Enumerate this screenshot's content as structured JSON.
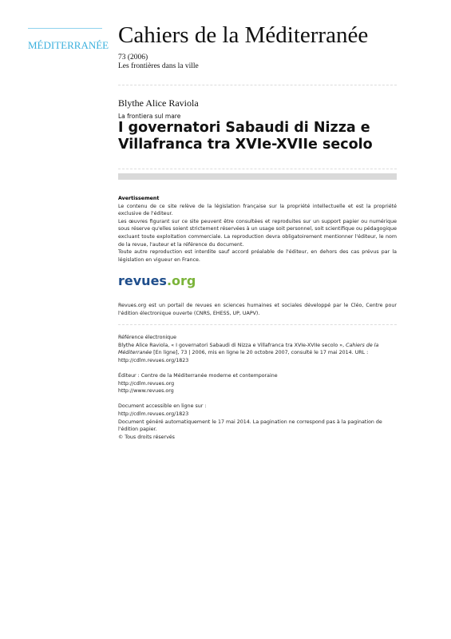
{
  "logo": {
    "text": "MÉDITERRANÉE"
  },
  "header": {
    "journal": "Cahiers de la Méditerranée",
    "issue": "73  (2006)",
    "theme": "Les frontières dans la ville"
  },
  "article": {
    "author": "Blythe Alice Raviola",
    "subtitle": "La frontiera sul mare",
    "title": "I governatori Sabaudi di Nizza e Villafranca tra XVIe-XVIIe secolo"
  },
  "warning": {
    "heading": "Avertissement",
    "paragraphs": [
      "Le contenu de ce site relève de la législation française sur la propriété intellectuelle et est la propriété exclusive de l'éditeur.",
      "Les œuvres figurant sur ce site peuvent être consultées et reproduites sur un support papier ou numérique sous réserve qu'elles soient strictement réservées à un usage soit personnel, soit scientifique ou pédagogique excluant toute exploitation commerciale. La reproduction devra obligatoirement mentionner l'éditeur, le nom de la revue, l'auteur et la référence du document.",
      "Toute autre reproduction est interdite sauf accord préalable de l'éditeur, en dehors des cas prévus par la législation en vigueur en France."
    ]
  },
  "revues": {
    "logo_a": "revues",
    "logo_b": ".org",
    "text": "Revues.org est un portail de revues en sciences humaines et sociales développé par le Cléo, Centre pour l'édition électronique ouverte (CNRS, EHESS, UP, UAPV)."
  },
  "reference": {
    "heading": "Référence électronique",
    "citation_a": "Blythe Alice Raviola, « I governatori Sabaudi di Nizza e Villafranca tra XVIe-XVIIe secolo », ",
    "citation_journal": "Cahiers de la Méditerranée",
    "citation_b": " [En ligne], 73 | 2006, mis en ligne le 20 octobre 2007, consulté le 17 mai 2014. URL : http://cdlm.revues.org/1823",
    "publisher": "Éditeur : Centre de la Méditerranée moderne et contemporaine",
    "publisher_url1": "http://cdlm.revues.org",
    "publisher_url2": "http://www.revues.org",
    "access_label": "Document accessible en ligne sur :",
    "access_url": "http://cdlm.revues.org/1823",
    "generated": "Document généré automatiquement le 17 mai 2014. La pagination ne correspond pas à la pagination de l'édition papier.",
    "rights": "© Tous droits réservés"
  }
}
